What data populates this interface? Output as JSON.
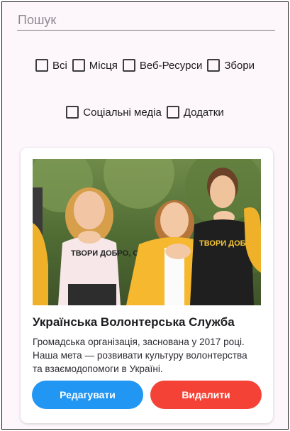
{
  "search": {
    "placeholder": "Пошук",
    "value": ""
  },
  "filters": [
    {
      "label": "Всі",
      "checked": false
    },
    {
      "label": "Місця",
      "checked": false
    },
    {
      "label": "Веб-Ресурси",
      "checked": false
    },
    {
      "label": "Збори",
      "checked": false
    },
    {
      "label": "Соціальні медіа",
      "checked": false
    },
    {
      "label": "Додатки",
      "checked": false
    }
  ],
  "card": {
    "image_text_1": "ТВОРИ ДОБРО, О!",
    "image_text_2": "ТВОРИ ДОБРО, О!",
    "title": "Українська Волонтерська Служба",
    "description": "Громадська організація, заснована у 2017 році. Наша мета — розвивати культуру волонтерства та взаємодопомоги в Україні.",
    "edit_label": "Редагувати",
    "delete_label": "Видалити"
  },
  "colors": {
    "background": "#fdf7fc",
    "edit_button": "#2196f3",
    "delete_button": "#f44336",
    "jacket": "#f5b82e"
  }
}
